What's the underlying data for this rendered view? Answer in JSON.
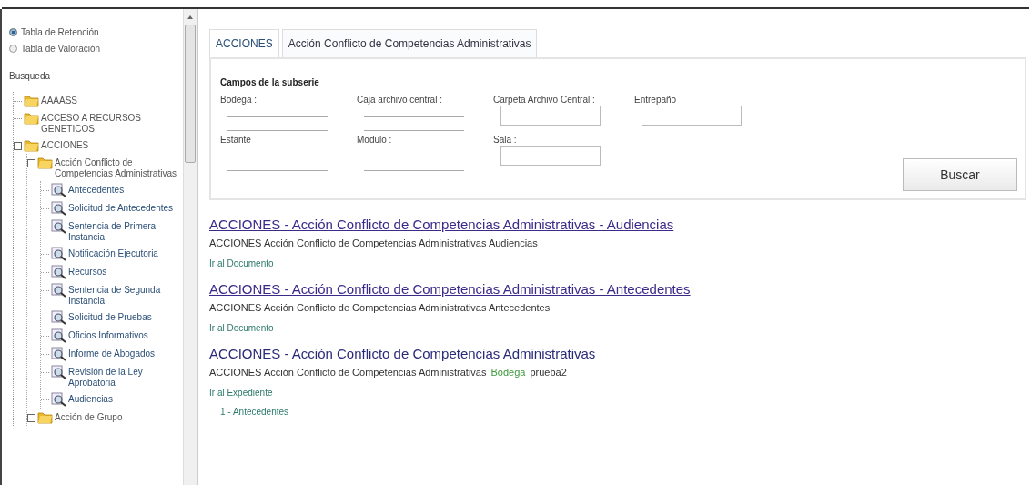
{
  "sidebar": {
    "radios": [
      {
        "label": "Tabla de Retención",
        "selected": true
      },
      {
        "label": "Tabla de Valoración",
        "selected": false
      }
    ],
    "search_title": "Busqueda",
    "tree": [
      {
        "label": "AAAASS",
        "kind": "folder",
        "expanded": false
      },
      {
        "label": "ACCESO A RECURSOS GENETICOS",
        "kind": "folder",
        "expanded": false
      },
      {
        "label": "ACCIONES",
        "kind": "folder",
        "expanded": true,
        "children": [
          {
            "label": "Acción Conflicto de Competencias Administrativas",
            "kind": "folder",
            "expanded": true,
            "children": [
              {
                "label": "Antecedentes",
                "kind": "document"
              },
              {
                "label": "Solicitud de Antecedentes",
                "kind": "document"
              },
              {
                "label": "Sentencia de Primera Instancia",
                "kind": "document"
              },
              {
                "label": "Notificación Ejecutoria",
                "kind": "document"
              },
              {
                "label": "Recursos",
                "kind": "document"
              },
              {
                "label": "Sentencia de Segunda Instancia",
                "kind": "document"
              },
              {
                "label": "Solicitud de Pruebas",
                "kind": "document"
              },
              {
                "label": "Oficios Informativos",
                "kind": "document"
              },
              {
                "label": "Informe de Abogados",
                "kind": "document"
              },
              {
                "label": "Revisión de la Ley Aprobatoria",
                "kind": "document"
              },
              {
                "label": "Audiencias",
                "kind": "document"
              }
            ]
          },
          {
            "label": "Acción de Grupo",
            "kind": "folder",
            "expanded": true
          }
        ]
      }
    ]
  },
  "tabs": [
    {
      "label": "ACCIONES",
      "selected": false
    },
    {
      "label": "Acción Conflicto de Competencias Administrativas",
      "selected": true
    }
  ],
  "form": {
    "title": "Campos de la subserie",
    "fields": [
      {
        "label": "Bodega :",
        "kind": "line"
      },
      {
        "label": "Caja archivo central :",
        "kind": "line"
      },
      {
        "label": "Carpeta Archivo Central :",
        "kind": "box"
      },
      {
        "label": "Entrepaño",
        "kind": "box"
      },
      {
        "label": "Estante",
        "kind": "line"
      },
      {
        "label": "Modulo :",
        "kind": "line"
      },
      {
        "label": "Sala :",
        "kind": "box"
      }
    ],
    "button": "Buscar"
  },
  "results": [
    {
      "title": "ACCIONES - Acción Conflicto de Competencias Administrativas - Audiencias",
      "visited": true,
      "description": "ACCIONES  Acción Conflicto de Competencias Administrativas  Audiencias",
      "link": "Ir al Documento"
    },
    {
      "title": "ACCIONES - Acción Conflicto de Competencias Administrativas - Antecedentes",
      "visited": true,
      "description": "ACCIONES  Acción Conflicto de Competencias Administrativas  Antecedentes",
      "link": "Ir al Documento"
    },
    {
      "title": "ACCIONES - Acción Conflicto de Competencias Administrativas",
      "visited": false,
      "description": "ACCIONES  Acción Conflicto de Competencias Administrativas",
      "tag": "Bodega",
      "tag_value": "prueba2",
      "link": "Ir al Expediente",
      "subitems": [
        "1 - Antecedentes"
      ]
    }
  ]
}
